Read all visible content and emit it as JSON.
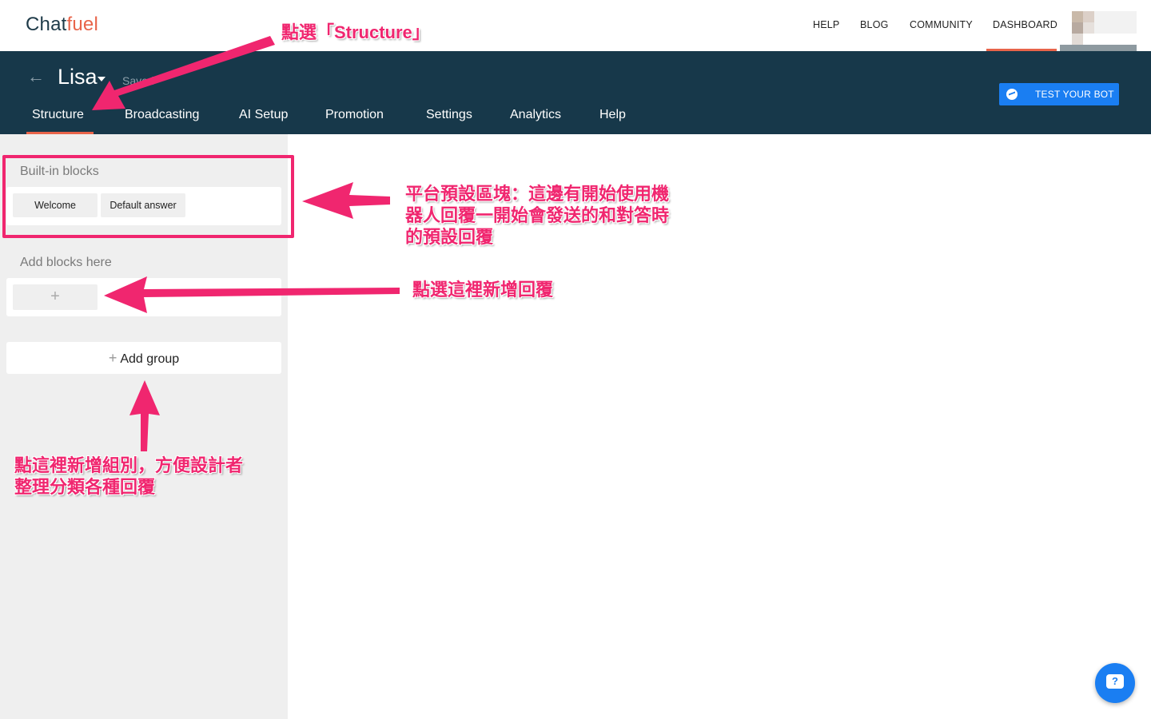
{
  "topnav": {
    "logo_left": "Chat",
    "logo_right": "fuel",
    "links": [
      "HELP",
      "BLOG",
      "COMMUNITY",
      "DASHBOARD"
    ],
    "active_link": "DASHBOARD"
  },
  "bot_header": {
    "name": "Lisa",
    "status": "Saved",
    "tabs": [
      "Structure",
      "Broadcasting",
      "AI Setup",
      "Promotion",
      "Settings",
      "Analytics",
      "Help"
    ],
    "active_tab": "Structure",
    "test_button": "TEST YOUR BOT"
  },
  "sidebar": {
    "builtin_title": "Built-in blocks",
    "builtin_blocks": [
      "Welcome",
      "Default answer"
    ],
    "add_title": "Add blocks here",
    "add_block_symbol": "+",
    "add_group_label": "Add group",
    "add_group_symbol": "+"
  },
  "annotations": {
    "structure_note": "點選「Structure」",
    "builtin_note_lines": [
      "平台預設區塊：這邊有開始使用機",
      "器人回覆一開始會發送的和對答時",
      "的預設回覆"
    ],
    "add_block_note": "點選這裡新增回覆",
    "add_group_note_lines": [
      "點這裡新增組別，方便設計者",
      "整理分類各種回覆"
    ]
  },
  "help_fab": {
    "symbol": "?"
  },
  "colors": {
    "accent": "#e8644a",
    "header_bg": "#17384a",
    "primary_blue": "#1a7ef2",
    "annotation": "#f0266f"
  }
}
